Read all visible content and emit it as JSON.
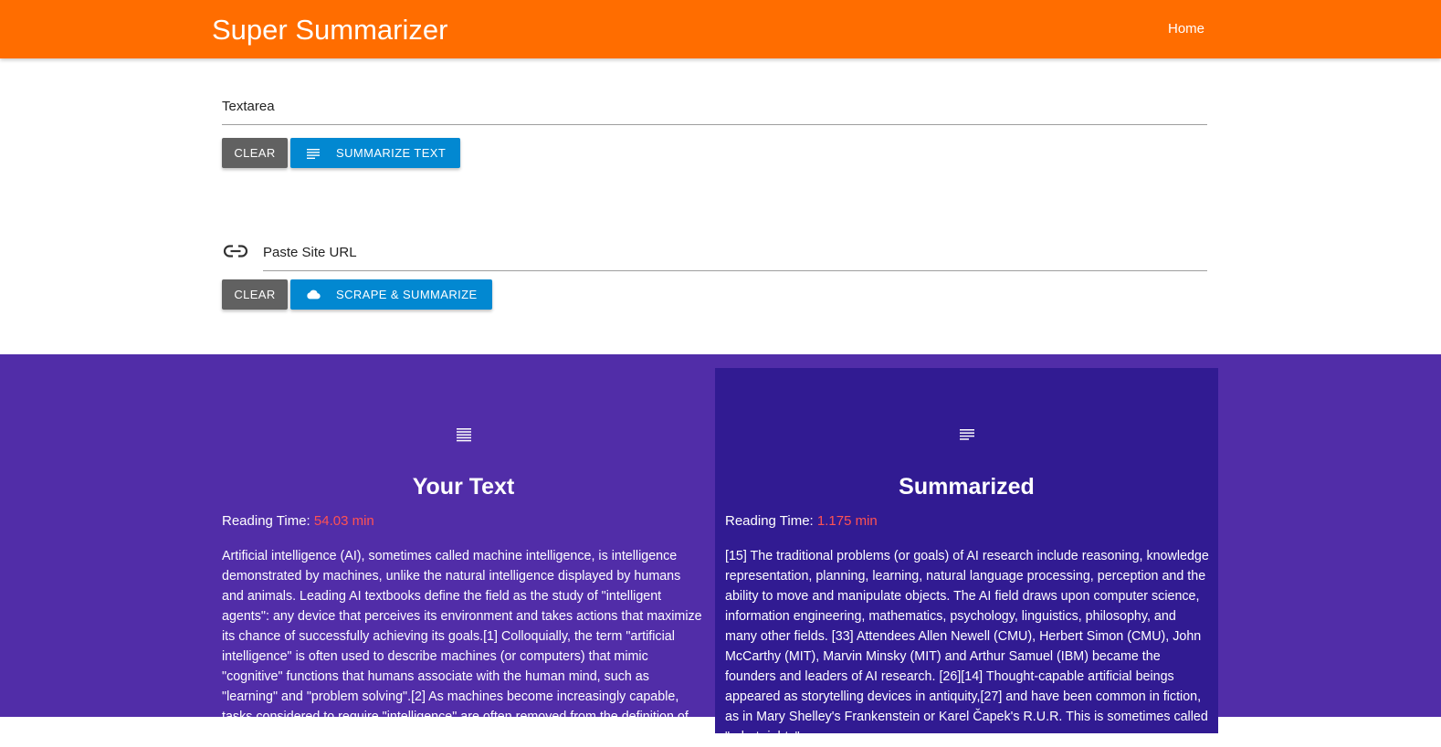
{
  "nav": {
    "brand": "Super Summarizer",
    "home_link": "Home"
  },
  "text_form": {
    "placeholder": "Textarea",
    "value": "",
    "clear_label": "CLEAR",
    "submit_label": "SUMMARIZE TEXT",
    "submit_icon": "subject-icon"
  },
  "url_form": {
    "icon": "link-icon",
    "placeholder": "Paste Site URL",
    "value": "",
    "clear_label": "CLEAR",
    "submit_label": "SCRAPE & SUMMARIZE",
    "submit_icon": "cloud-icon"
  },
  "results": {
    "original": {
      "icon": "format-align-justify-icon",
      "title": "Your Text",
      "reading_label": "Reading Time:",
      "reading_value": "54.03 min",
      "text": "Artificial intelligence (AI), sometimes called machine intelligence, is intelligence demonstrated by machines, unlike the natural intelligence displayed by humans and animals. Leading AI textbooks define the field as the study of \"intelligent agents\": any device that perceives its environment and takes actions that maximize its chance of successfully achieving its goals.[1] Colloquially, the term \"artificial intelligence\" is often used to describe machines (or computers) that mimic \"cognitive\" functions that humans associate with the human mind, such as \"learning\" and \"problem solving\".[2] As machines become increasingly capable, tasks considered to require \"intelligence\" are often removed from the definition of AI, a phenomenon known as the AI effect."
    },
    "summary": {
      "icon": "subject-icon",
      "title": "Summarized",
      "reading_label": "Reading Time:",
      "reading_value": "1.175 min",
      "text": "[15] The traditional problems (or goals) of AI research include reasoning, knowledge representation, planning, learning, natural language processing, perception and the ability to move and manipulate objects. The AI field draws upon computer science, information engineering, mathematics, psychology, linguistics, philosophy, and many other fields. [33] Attendees Allen Newell (CMU), Herbert Simon (CMU), John McCarthy (MIT), Marvin Minsky (MIT) and Arthur Samuel (IBM) became the founders and leaders of AI research. [26][14] Thought-capable artificial beings appeared as storytelling devices in antiquity,[27] and have been common in fiction, as in Mary Shelley's Frankenstein or Karel Čapek's R.U.R. This is sometimes called \"robot rights\"."
    }
  },
  "colors": {
    "navbar": "#ff6d00",
    "primary_button": "#0288d1",
    "clear_button": "#616161",
    "results_bg": "#512da8",
    "summary_bg": "#311b92",
    "reading_value": "#ff5252"
  }
}
